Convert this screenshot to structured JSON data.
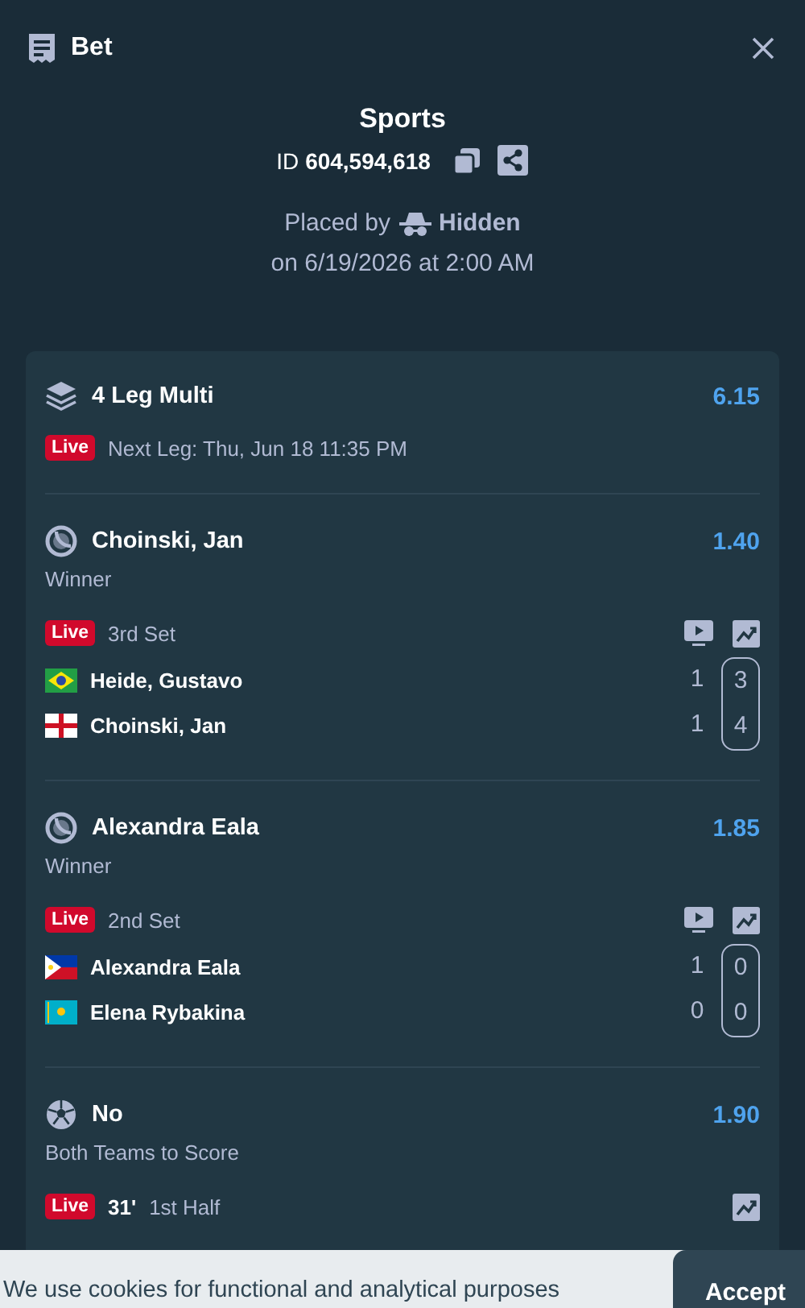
{
  "header": {
    "title": "Bet"
  },
  "summary": {
    "title": "Sports",
    "id_label": "ID",
    "id": "604,594,618",
    "placed_by_label": "Placed by",
    "placer": "Hidden",
    "placed_on": "on 6/19/2026 at 2:00 AM"
  },
  "multi": {
    "title": "4 Leg Multi",
    "odds": "6.15",
    "live_label": "Live",
    "next_leg": "Next Leg: Thu, Jun 18 11:35 PM"
  },
  "legs": [
    {
      "kind": "tennis",
      "selection": "Choinski, Jan",
      "odds": "1.40",
      "market": "Winner",
      "live_label": "Live",
      "period": "3rd Set",
      "stream": true,
      "players": [
        {
          "name": "Heide, Gustavo",
          "kind": "br",
          "scores": [
            "1",
            "3"
          ]
        },
        {
          "name": "Choinski, Jan",
          "kind": "en",
          "scores": [
            "1",
            "4"
          ]
        }
      ]
    },
    {
      "kind": "tennis",
      "selection": "Alexandra Eala",
      "odds": "1.85",
      "market": "Winner",
      "live_label": "Live",
      "period": "2nd Set",
      "stream": true,
      "players": [
        {
          "name": "Alexandra Eala",
          "kind": "ph",
          "scores": [
            "1",
            "0"
          ]
        },
        {
          "name": "Elena Rybakina",
          "kind": "kz",
          "scores": [
            "0",
            "0"
          ]
        }
      ]
    },
    {
      "kind": "soccer",
      "selection": "No",
      "odds": "1.90",
      "market": "Both Teams to Score",
      "live_label": "Live",
      "clock": "31'",
      "period": "1st Half",
      "stream": false
    }
  ],
  "cookie_bar": {
    "text": "We use cookies for functional and analytical purposes",
    "button": "Accept"
  }
}
